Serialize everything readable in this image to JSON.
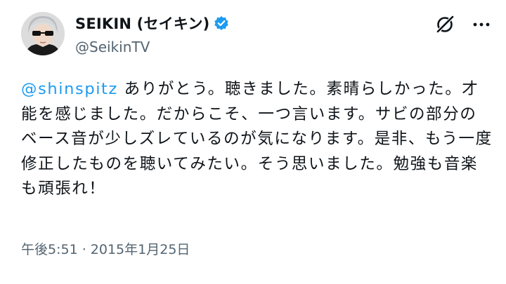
{
  "author": {
    "display_name": "SEIKIN (セイキン)",
    "handle": "@SeikinTV"
  },
  "icons": {
    "verified": "verified-badge-icon",
    "grok": "grok-icon",
    "more": "more-options-icon",
    "avatar": "avatar"
  },
  "colors": {
    "mention": "#1d9bf0",
    "verified": "#1d9bf0",
    "secondary_text": "#536471"
  },
  "tweet": {
    "mention": "@shinspitz",
    "text": " ありがとう。聴きました。素晴らしかった。才能を感じました。だからこそ、一つ言います。サビの部分のベース音が少しズレているのが気になります。是非、もう一度修正したものを聴いてみたい。そう思いました。勉強も音楽も頑張れ！",
    "timestamp": "午後5:51 · 2015年1月25日"
  }
}
